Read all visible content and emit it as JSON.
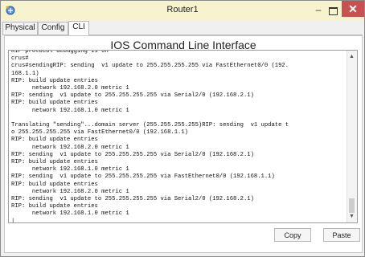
{
  "window": {
    "title": "Router1",
    "minimize_glyph": "–",
    "close_glyph": "✕",
    "icon": "router-app-icon",
    "close_color": "#c75050",
    "titlebar_color": "#f7f3cf"
  },
  "tabs": [
    {
      "label": "Physical",
      "active": false
    },
    {
      "label": "Config",
      "active": false
    },
    {
      "label": "CLI",
      "active": true
    }
  ],
  "panel": {
    "title": "IOS Command Line Interface"
  },
  "console": {
    "text": "RIP protocol debugging is on\ncrus#\ncrus#sendingRIP: sending  v1 update to 255.255.255.255 via FastEthernet0/0 (192.\n168.1.1)\nRIP: build update entries\n      network 192.168.2.0 metric 1\nRIP: sending  v1 update to 255.255.255.255 via Serial2/0 (192.168.2.1)\nRIP: build update entries\n      network 192.168.1.0 metric 1\n\nTranslating \"sending\"...domain server (255.255.255.255)RIP: sending  v1 update t\no 255.255.255.255 via FastEthernet0/0 (192.168.1.1)\nRIP: build update entries\n      network 192.168.2.0 metric 1\nRIP: sending  v1 update to 255.255.255.255 via Serial2/0 (192.168.2.1)\nRIP: build update entries\n      network 192.168.1.0 metric 1\nRIP: sending  v1 update to 255.255.255.255 via FastEthernet0/0 (192.168.1.1)\nRIP: build update entries\n      network 192.168.2.0 metric 1\nRIP: sending  v1 update to 255.255.255.255 via Serial2/0 (192.168.2.1)\nRIP: build update entries\n      network 192.168.1.0 metric 1\n|"
  },
  "buttons": {
    "copy": "Copy",
    "paste": "Paste"
  }
}
